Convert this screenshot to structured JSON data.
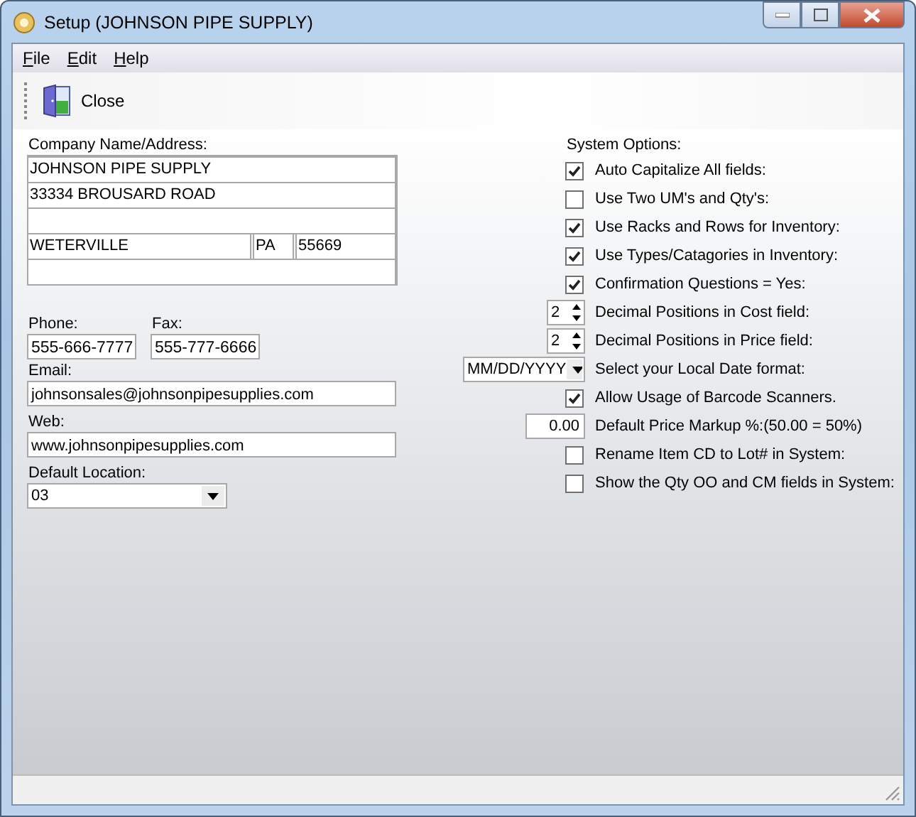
{
  "window": {
    "title": "Setup (JOHNSON PIPE SUPPLY)"
  },
  "menu": [
    "File",
    "Edit",
    "Help"
  ],
  "toolbar": [
    {
      "label": "Close"
    }
  ],
  "company": {
    "label": "Company Name/Address:",
    "lines": [
      "JOHNSON PIPE SUPPLY",
      "33334 BROUSARD ROAD"
    ],
    "city": "WETERVILLE",
    "state": "PA",
    "zip": "55669"
  },
  "phone": {
    "label": "Phone:",
    "value": "555-666-7777"
  },
  "fax": {
    "label": "Fax:",
    "value": "555-777-6666"
  },
  "email": {
    "label": "Email:",
    "value": "johnsonsales@johnsonpipesupplies.com"
  },
  "web": {
    "label": "Web:",
    "value": "www.johnsonpipesupplies.com"
  },
  "default_location": {
    "label": "Default Location:",
    "value": "03"
  },
  "system_options": {
    "label": "System Options:",
    "items": [
      {
        "kind": "checkbox",
        "label": "Auto Capitalize All fields:",
        "checked": true
      },
      {
        "kind": "checkbox",
        "label": "Use Two UM's and Qty's:",
        "checked": false
      },
      {
        "kind": "checkbox",
        "label": "Use Racks and Rows for Inventory:",
        "checked": true
      },
      {
        "kind": "checkbox",
        "label": "Use Types/Catagories in Inventory:",
        "checked": true
      },
      {
        "kind": "checkbox",
        "label": "Confirmation Questions = Yes:",
        "checked": true
      },
      {
        "kind": "spinner",
        "label": "Decimal Positions in Cost field:",
        "value": "2"
      },
      {
        "kind": "spinner",
        "label": "Decimal Positions in Price field:",
        "value": "2"
      },
      {
        "kind": "dropdown",
        "label": "Select your Local Date format:",
        "value": "MM/DD/YYYY"
      },
      {
        "kind": "checkbox",
        "label": "Allow Usage of Barcode Scanners.",
        "checked": true
      },
      {
        "kind": "number",
        "label": "Default Price Markup %:(50.00 = 50%)",
        "value": "0.00"
      },
      {
        "kind": "checkbox",
        "label": "Rename Item CD to Lot# in System:",
        "checked": false
      },
      {
        "kind": "checkbox",
        "label": "Show the Qty OO and CM fields in System:",
        "checked": false
      }
    ]
  }
}
